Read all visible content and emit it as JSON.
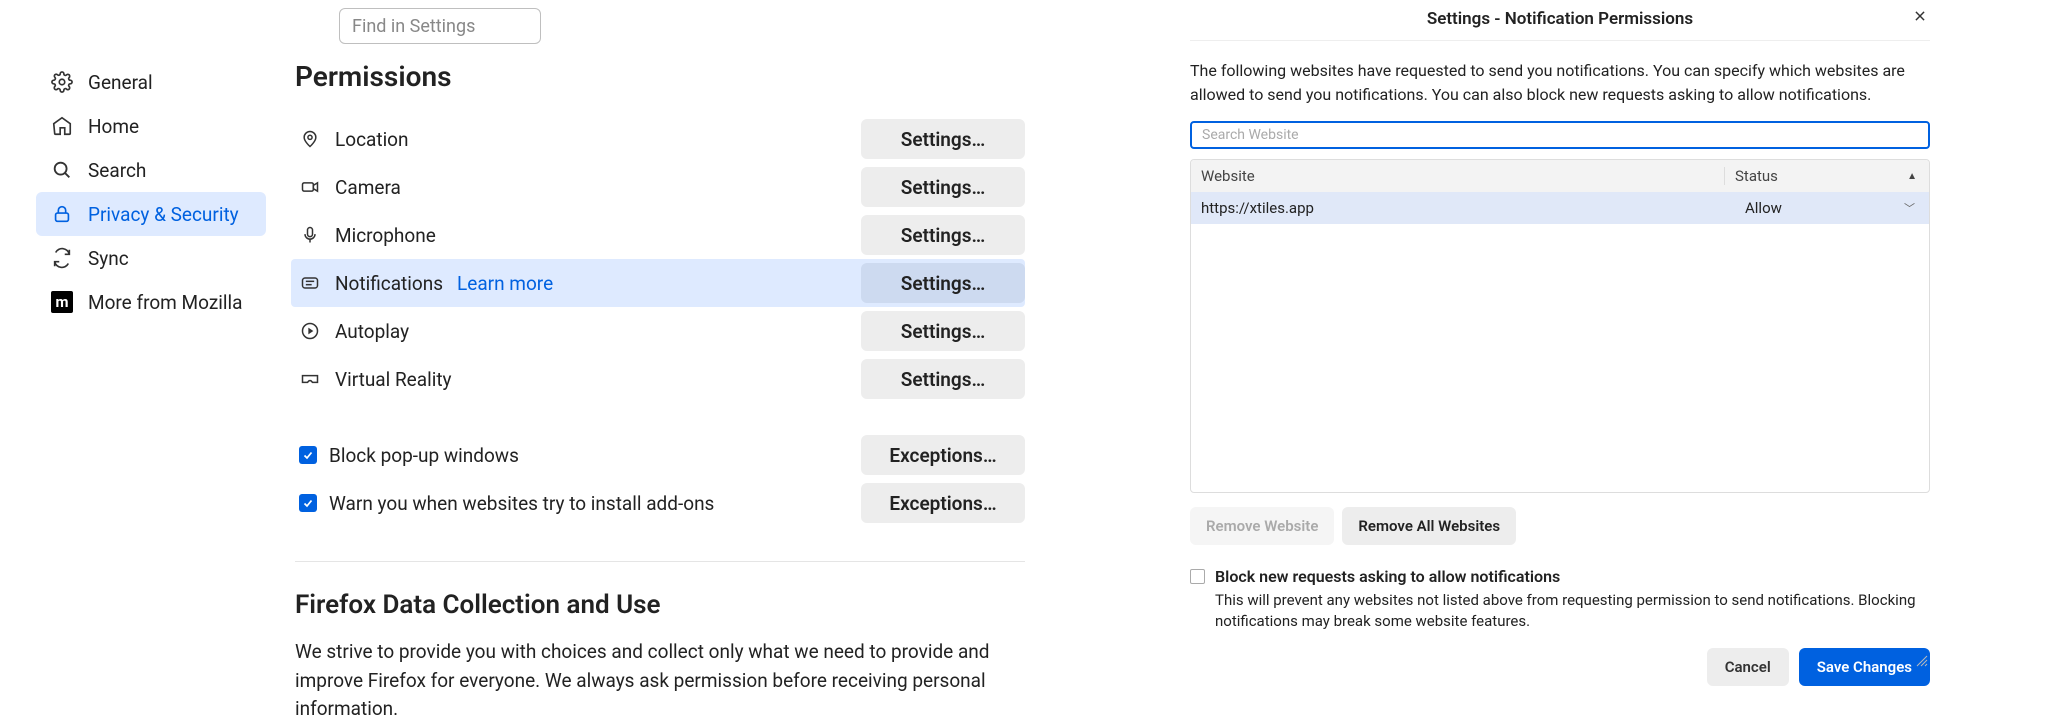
{
  "topbar": {
    "search_placeholder": "Find in Settings"
  },
  "sidebar": {
    "items": [
      {
        "label": "General"
      },
      {
        "label": "Home"
      },
      {
        "label": "Search"
      },
      {
        "label": "Privacy & Security"
      },
      {
        "label": "Sync"
      },
      {
        "label": "More from Mozilla"
      }
    ]
  },
  "permissions": {
    "title": "Permissions",
    "items": [
      {
        "label": "Location",
        "button": "Settings…"
      },
      {
        "label": "Camera",
        "button": "Settings…"
      },
      {
        "label": "Microphone",
        "button": "Settings…"
      },
      {
        "label": "Notifications",
        "learn_more": "Learn more",
        "button": "Settings…"
      },
      {
        "label": "Autoplay",
        "button": "Settings…"
      },
      {
        "label": "Virtual Reality",
        "button": "Settings…"
      }
    ],
    "checkboxes": [
      {
        "label": "Block pop-up windows",
        "button": "Exceptions…",
        "checked": true
      },
      {
        "label": "Warn you when websites try to install add-ons",
        "button": "Exceptions…",
        "checked": true
      }
    ]
  },
  "data_collect": {
    "title": "Firefox Data Collection and Use",
    "body": "We strive to provide you with choices and collect only what we need to provide and improve Firefox for everyone. We always ask permission before receiving personal information."
  },
  "dialog": {
    "title": "Settings - Notification Permissions",
    "description": "The following websites have requested to send you notifications. You can specify which websites are allowed to send you notifications. You can also block new requests asking to allow notifications.",
    "search_placeholder": "Search Website",
    "headers": {
      "website": "Website",
      "status": "Status"
    },
    "rows": [
      {
        "website": "https://xtiles.app",
        "status": "Allow"
      }
    ],
    "remove_website": "Remove Website",
    "remove_all": "Remove All Websites",
    "block_checkbox": "Block new requests asking to allow notifications",
    "block_sub": "This will prevent any websites not listed above from requesting permission to send notifications. Blocking notifications may break some website features.",
    "cancel": "Cancel",
    "save": "Save Changes"
  }
}
